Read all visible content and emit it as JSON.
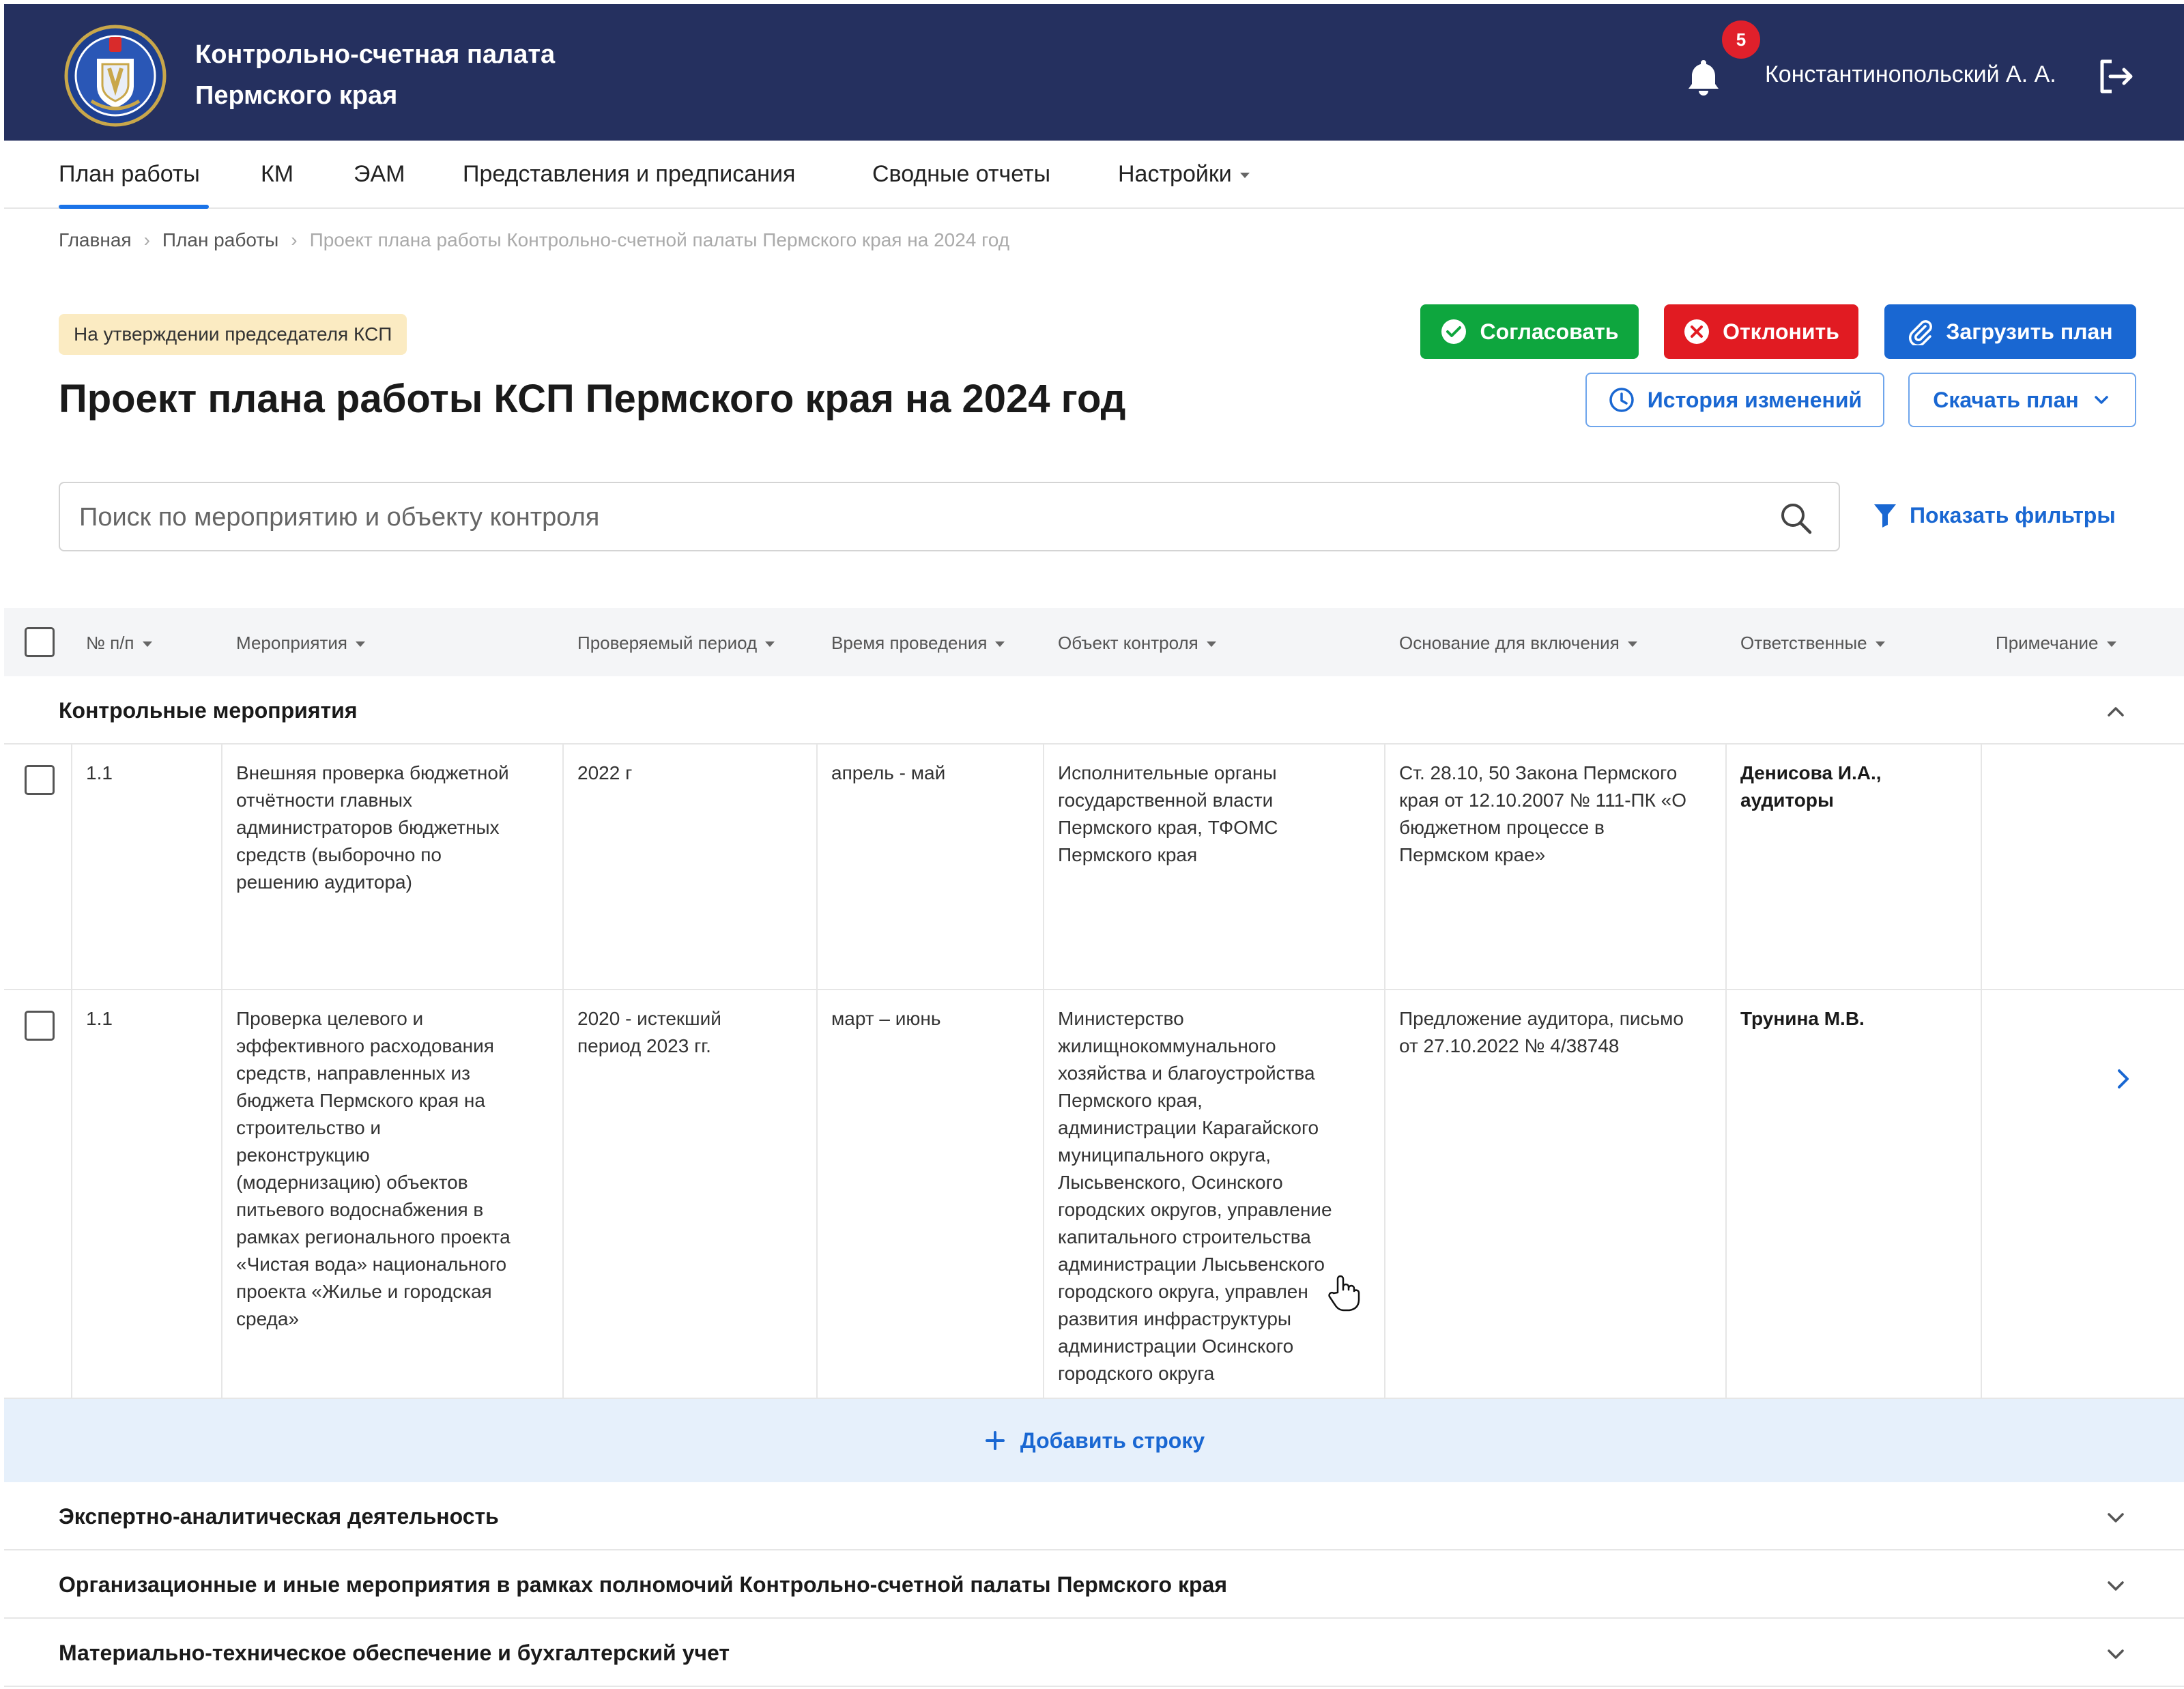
{
  "header": {
    "org_line1": "Контрольно-счетная палата",
    "org_line2": "Пермского края",
    "notifications_count": "5",
    "user_name": "Константинопольский А. А."
  },
  "nav": {
    "items": [
      {
        "label": "План работы",
        "active": true
      },
      {
        "label": "КМ"
      },
      {
        "label": "ЭАМ"
      },
      {
        "label": "Представления и предписания"
      },
      {
        "label": "Сводные отчеты"
      },
      {
        "label": "Настройки"
      }
    ]
  },
  "breadcrumb": {
    "items": [
      "Главная",
      "План работы",
      "Проект плана работы Контрольно-счетной палаты Пермского края на 2024 год"
    ]
  },
  "page": {
    "status": "На утверждении председателя КСП",
    "title": "Проект плана работы КСП Пермского края на 2024 год"
  },
  "actions": {
    "approve": "Согласовать",
    "reject": "Отклонить",
    "upload": "Загрузить план",
    "history": "История изменений",
    "download": "Скачать план"
  },
  "search": {
    "placeholder": "Поиск по мероприятию и объекту контроля",
    "filters_label": "Показать фильтры"
  },
  "table": {
    "columns": [
      "№ п/п",
      "Мероприятия",
      "Проверяемый период",
      "Время проведения",
      "Объект контроля",
      "Основание для включения",
      "Ответственные",
      "Примечание"
    ],
    "sections": [
      {
        "title": "Контрольные мероприятия",
        "expanded": true,
        "rows": [
          {
            "num": "1.1",
            "event": [
              "Внешняя проверка бюджетной",
              "отчётности главных",
              "администраторов бюджетных",
              "средств (выборочно по",
              "решению аудитора)"
            ],
            "period": [
              "2022 г"
            ],
            "time": [
              "апрель - май"
            ],
            "object": [
              "Исполнительные органы",
              "государственной власти",
              "Пермского края, ТФОМС",
              "Пермского края"
            ],
            "basis": [
              "Ст. 28.10, 50 Закона Пермского",
              "края от 12.10.2007 № 111-ПК «О",
              "бюджетном процессе в",
              "Пермском крае»"
            ],
            "responsible": [
              "Денисова И.А.,",
              "аудиторы"
            ],
            "note": ""
          },
          {
            "num": "1.1",
            "event": [
              "Проверка целевого и",
              "эффективного расходования",
              "средств, направленных из",
              "бюджета Пермского края на",
              "строительство и",
              "реконструкцию",
              "(модернизацию) объектов",
              "питьевого водоснабжения в",
              "рамках регионального проекта",
              "«Чистая вода» национального",
              "проекта «Жилье и городская",
              "среда»"
            ],
            "period": [
              "2020 - истекший",
              "период 2023 гг."
            ],
            "time": [
              "март – июнь"
            ],
            "object": [
              "Министерство",
              "жилищнокоммунального",
              "хозяйства и благоустройства",
              "Пермского края,",
              "администрации Карагайского",
              "муниципального округа,",
              "Лысьвенского, Осинского",
              "городских округов, управление",
              "капитального строительства",
              "администрации Лысьвенского",
              "городского округа, управлен",
              "развития инфраструктуры",
              "администрации Осинского",
              "городского округа"
            ],
            "basis": [
              "Предложение аудитора, письмо",
              "от 27.10.2022 № 4/38748"
            ],
            "responsible": [
              "Трунина М.В."
            ],
            "note": ""
          }
        ],
        "add_row_label": "Добавить строку"
      },
      {
        "title": "Экспертно-аналитическая деятельность",
        "expanded": false
      },
      {
        "title": "Организационные и иные мероприятия в рамках полномочий Контрольно-счетной палаты Пермского края",
        "expanded": false
      },
      {
        "title": "Материально-техническое обеспечение и бухгалтерский учет",
        "expanded": false
      }
    ]
  },
  "icons": {
    "logo": "ksp-emblem",
    "bell": "bell-icon",
    "logout": "logout-icon",
    "search": "search-icon",
    "filter": "filter-icon"
  },
  "colors": {
    "header_bg": "#25305f",
    "accent": "#1967d2",
    "approve": "#0ea63e",
    "reject": "#e11b22",
    "status_bg": "#fbebc2",
    "add_row_bg": "#e6f0fb"
  }
}
